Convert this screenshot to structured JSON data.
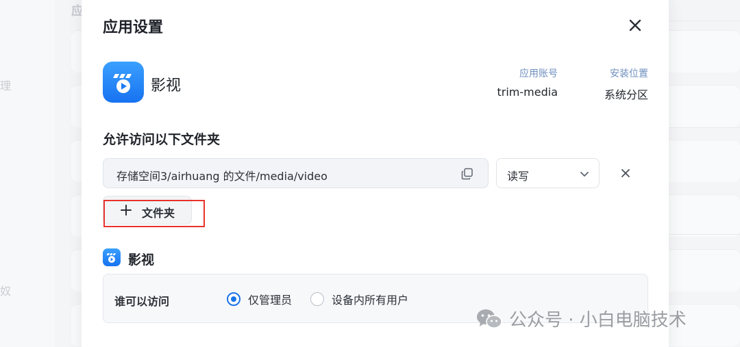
{
  "background": {
    "heading_fragment": "应",
    "sidebar_fragments": [
      "理",
      "奴"
    ]
  },
  "dialog": {
    "title": "应用设置",
    "app": {
      "name": "影视",
      "account_label": "应用账号",
      "account_value": "trim-media",
      "location_label": "安装位置",
      "location_value": "系统分区"
    },
    "folders_section": {
      "title": "允许访问以下文件夹",
      "path": "存储空间3/airhuang 的文件/media/video",
      "permission": "读写",
      "add_folder_label": "文件夹"
    },
    "access_section": {
      "title": "影视",
      "who_label": "谁可以访问",
      "options": [
        {
          "label": "仅管理员",
          "checked": true
        },
        {
          "label": "设备内所有用户",
          "checked": false
        }
      ]
    }
  },
  "watermark": "公众号 · 小白电脑技术",
  "colors": {
    "accent": "#1a73e8",
    "highlight": "#e8322b",
    "app_icon_top": "#3aa0ff",
    "app_icon_bottom": "#1772f0"
  },
  "icons": [
    "close-icon",
    "copy-icon",
    "chevron-down-icon",
    "remove-icon",
    "plus-icon",
    "app-logo-icon",
    "wechat-icon"
  ]
}
